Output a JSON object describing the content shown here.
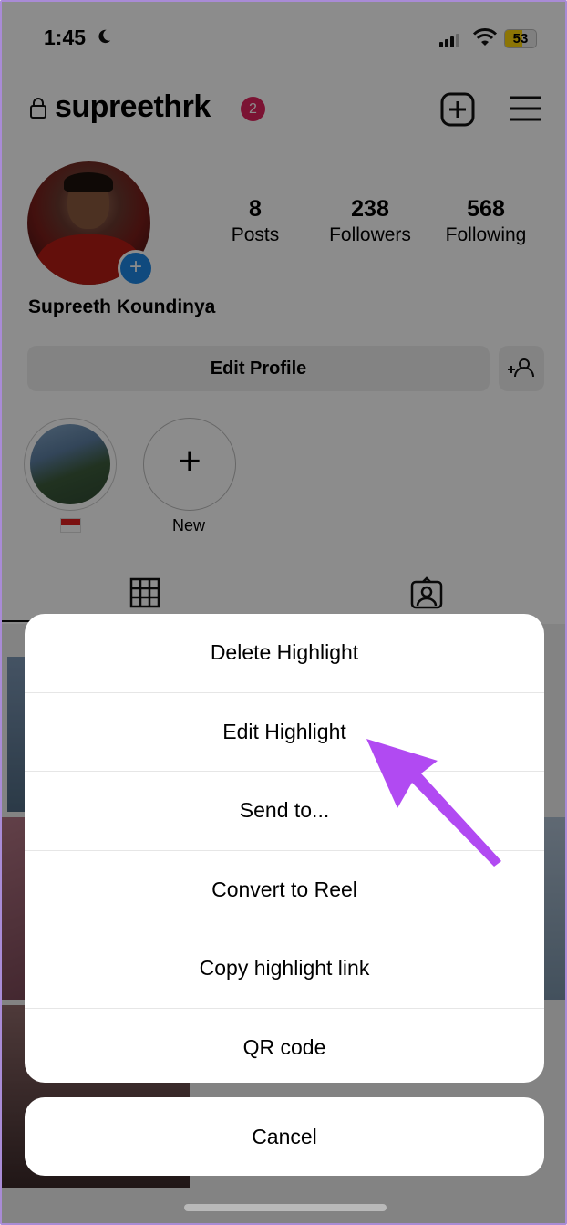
{
  "status_bar": {
    "time": "1:45",
    "battery": "53"
  },
  "profile": {
    "username": "supreethrk",
    "notification_count": "2",
    "full_name": "Supreeth Koundinya",
    "stats": [
      {
        "value": "8",
        "label": "Posts"
      },
      {
        "value": "238",
        "label": "Followers"
      },
      {
        "value": "568",
        "label": "Following"
      }
    ],
    "edit_profile_label": "Edit Profile"
  },
  "highlights": [
    {
      "label": "",
      "icon": "indonesia-flag"
    },
    {
      "label": "New",
      "icon": "plus-icon"
    }
  ],
  "action_sheet": {
    "items": [
      "Delete Highlight",
      "Edit Highlight",
      "Send to...",
      "Convert to Reel",
      "Copy highlight link",
      "QR code"
    ],
    "cancel_label": "Cancel"
  },
  "colors": {
    "notification_badge": "#e0245e",
    "avatar_plus": "#1e88e5",
    "pointer_arrow": "#b14af2",
    "overlay": "rgba(0,0,0,0.45)"
  }
}
